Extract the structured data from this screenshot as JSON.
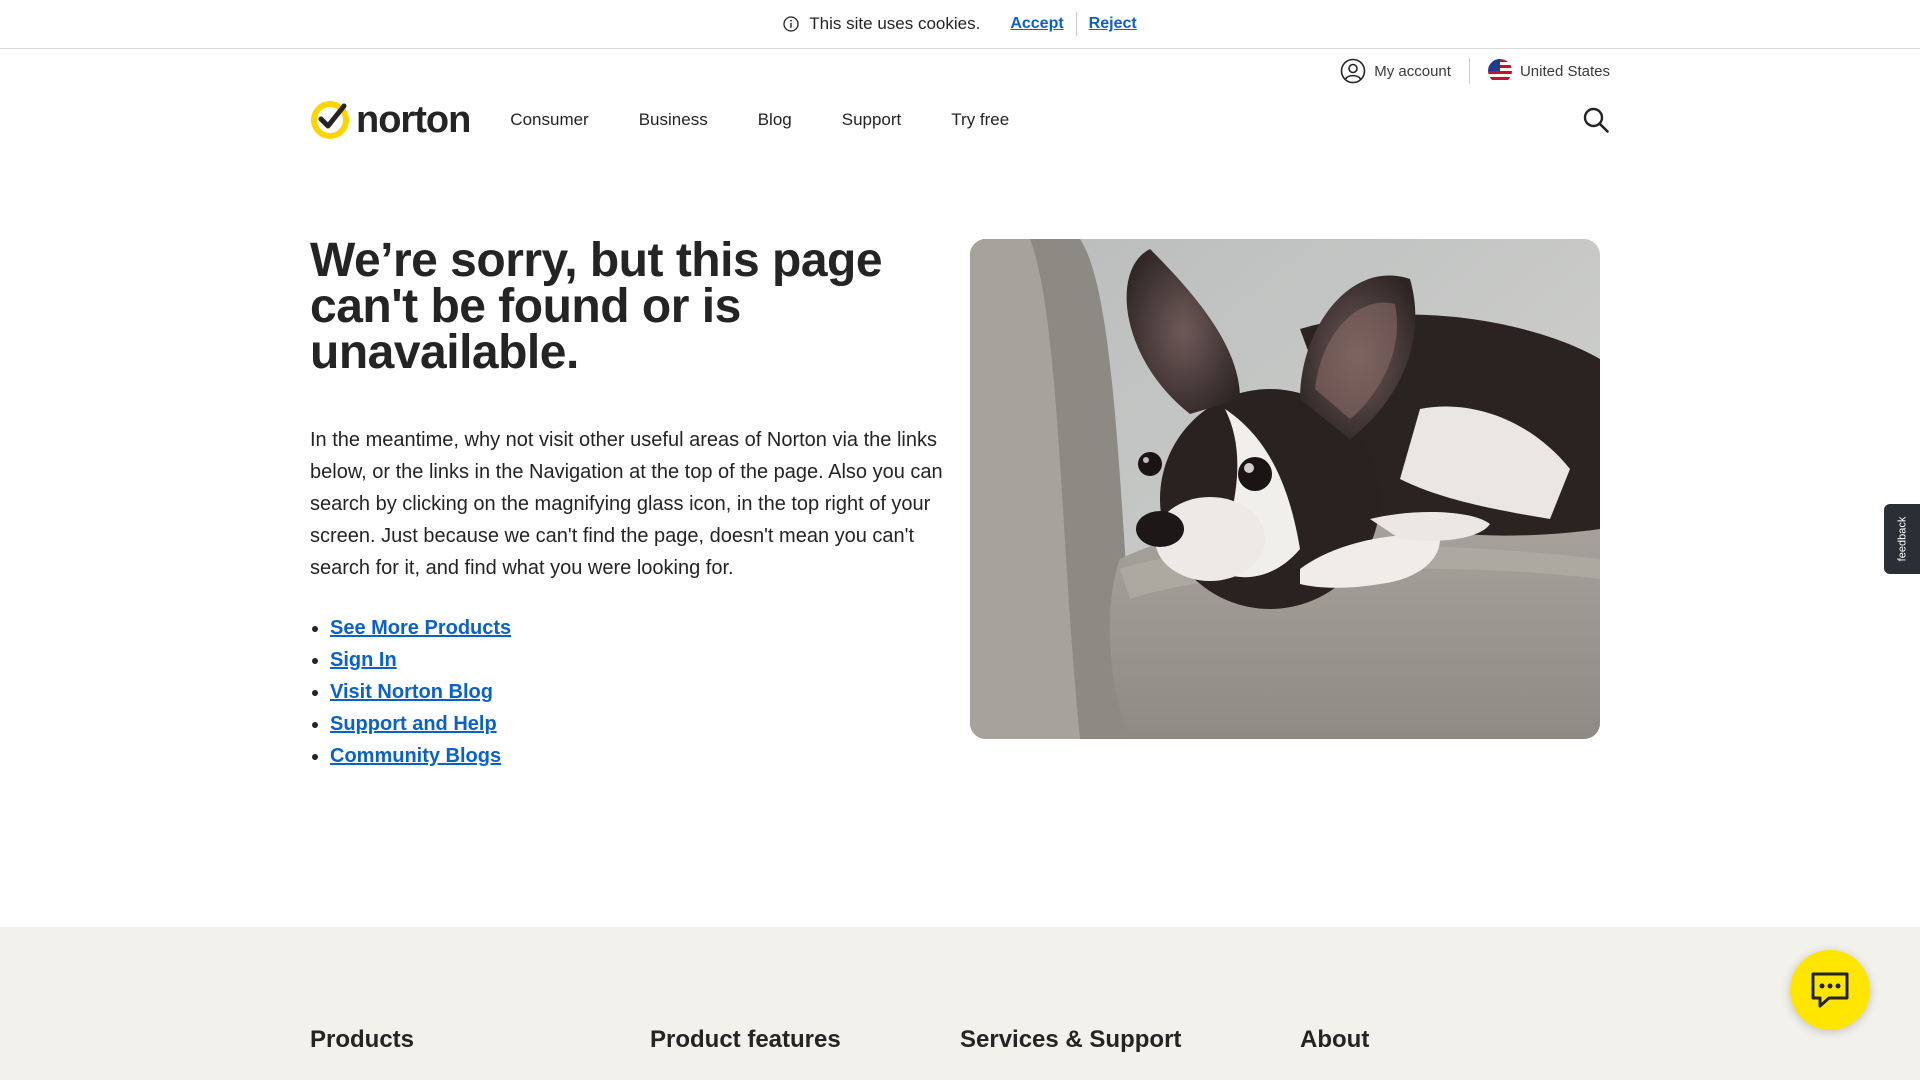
{
  "cookie_banner": {
    "text": "This site uses cookies.",
    "accept_label": "Accept",
    "reject_label": "Reject"
  },
  "utility_nav": {
    "account_label": "My account",
    "region_label": "United States"
  },
  "header": {
    "logo_text": "norton",
    "nav_items": [
      "Consumer",
      "Business",
      "Blog",
      "Support",
      "Try free"
    ]
  },
  "main": {
    "headline": "We’re sorry, but this page can't be found or is unavailable.",
    "description": "In the meantime, why not visit other useful areas of Norton via the links below, or the links in the Navigation at the top of the page. Also you can search by clicking on the magnifying glass icon, in the top right of your screen. Just because we can't find the page, doesn't mean you can't search for it, and find what you were looking for.",
    "links": [
      "See More Products",
      "Sign In",
      "Visit Norton Blog",
      "Support and Help",
      "Community Blogs"
    ]
  },
  "feedback_label": "feedback",
  "footer": {
    "headings": [
      "Products",
      "Product features",
      "Services & Support",
      "About"
    ]
  },
  "colors": {
    "link": "#0b62c6",
    "brand_yellow": "#ffe600",
    "footer_bg": "#f3f1ec"
  },
  "icons": [
    "info-icon",
    "account-icon",
    "flag-icon",
    "norton-check-icon",
    "search-icon",
    "chat-icon"
  ]
}
